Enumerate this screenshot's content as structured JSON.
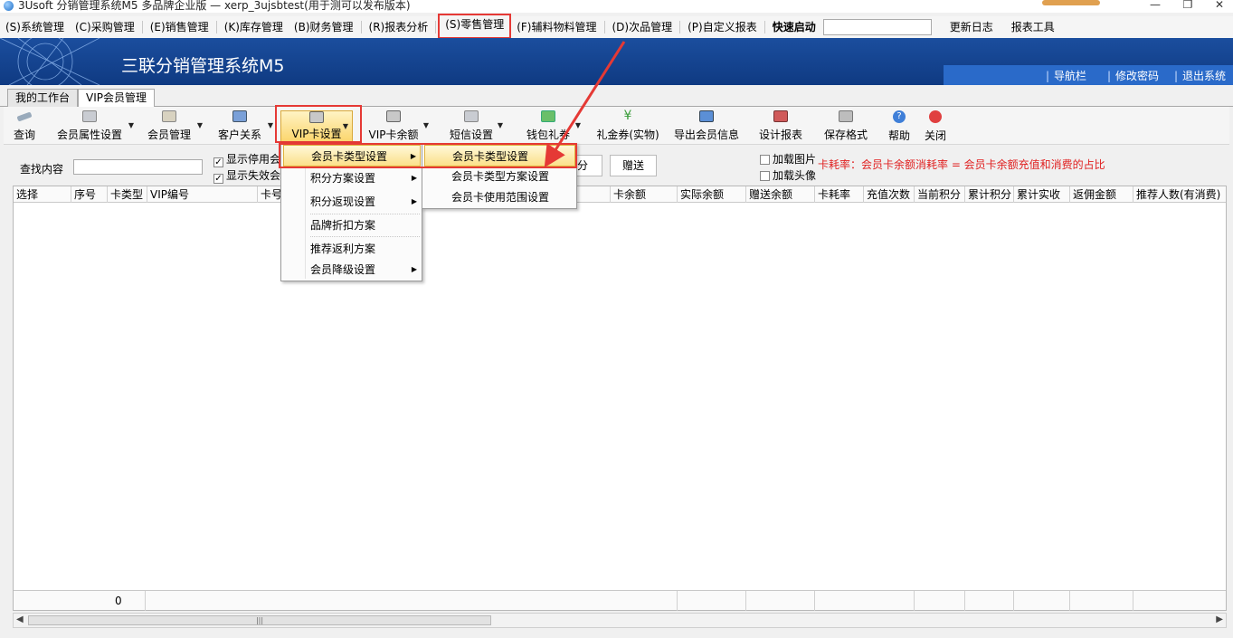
{
  "window": {
    "title": "3Usoft 分销管理系统M5 多品牌企业版 — xerp_3ujsbtest(用于测可以发布版本)",
    "app_icon": "app-logo-icon",
    "minimize": "—",
    "restore": "❐",
    "close": "✕"
  },
  "menubar": {
    "items": [
      "(S)系统管理",
      "(C)采购管理",
      "(E)销售管理",
      "(K)库存管理",
      "(B)财务管理",
      "(R)报表分析",
      "(S)零售管理",
      "(F)辅料物料管理",
      "(D)次品管理",
      "(P)自定义报表"
    ],
    "quick_start": "快速启动",
    "changelog": "更新日志",
    "report_tool": "报表工具"
  },
  "banner": {
    "title": "三联分销管理系统M5",
    "links": [
      "导航栏",
      "修改密码",
      "退出系统"
    ]
  },
  "tabs": [
    "我的工作台",
    "VIP会员管理"
  ],
  "toolbar": {
    "query": "查询",
    "member_attr": "会员属性设置",
    "member_mgmt": "会员管理",
    "customer_rel": "客户关系",
    "vip_card_settings": "VIP卡设置",
    "vip_card_balance": "VIP卡余额",
    "sms_settings": "短信设置",
    "wallet_gift": "钱包礼券",
    "coupon_physical": "礼金券(实物)",
    "export_member": "导出会员信息",
    "design_report": "设计报表",
    "save_format": "保存格式",
    "help": "帮助",
    "close": "关闭"
  },
  "filter": {
    "search_label": "查找内容",
    "search_value": "",
    "show_disabled": "显示停用会",
    "show_invalid": "显示失效会",
    "btn_points": "分",
    "btn_gift": "赠送",
    "load_image": "加载图片",
    "load_avatar": "加载头像",
    "note": "卡耗率：会员卡余额消耗率 =  会员卡余额充值和消费的占比"
  },
  "grid": {
    "columns": [
      "选择",
      "序号",
      "卡类型",
      "VIP编号",
      "卡号",
      "卡余额",
      "实际余额",
      "赠送余额",
      "卡耗率",
      "充值次数",
      "当前积分",
      "累计积分",
      "累计实收",
      "返佣金额",
      "推荐人数(有消费)"
    ],
    "footer_count": "0"
  },
  "vip_menu": {
    "items": [
      "会员卡类型设置",
      "积分方案设置",
      "积分返现设置",
      "品牌折扣方案",
      "推荐返利方案",
      "会员降级设置"
    ],
    "has_submenu": [
      true,
      true,
      true,
      false,
      false,
      true
    ]
  },
  "card_type_submenu": {
    "items": [
      "会员卡类型设置",
      "会员卡类型方案设置",
      "会员卡使用范围设置"
    ]
  },
  "colors": {
    "highlight_box": "#e53935",
    "banner": "#1b4e9e",
    "note_text": "#e02020"
  }
}
